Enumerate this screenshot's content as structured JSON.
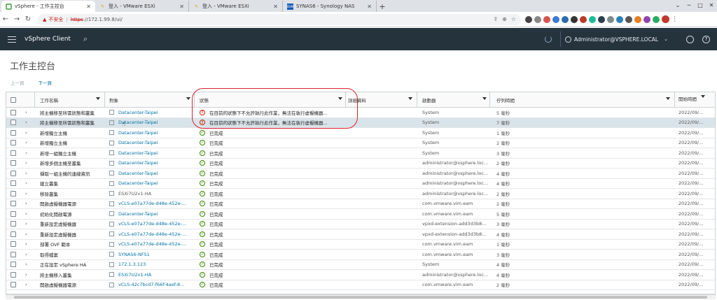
{
  "browser": {
    "tabs": [
      {
        "title": "vSphere - 工作主控台",
        "favicon": "vsphere-icon"
      },
      {
        "title": "登入 - VMware ESXi",
        "favicon": "vmware-icon"
      },
      {
        "title": "登入 - VMware ESXi",
        "favicon": "vmware-icon"
      },
      {
        "title": "SYNAS6 - Synology NAS",
        "favicon": "synology-icon"
      }
    ],
    "insecure_label": "不安全",
    "url_scheme": "https",
    "url_rest": "://172.1.99.8/ui/"
  },
  "header": {
    "brand": "vSphere Client",
    "user": "Administrator@VSPHERE.LOCAL"
  },
  "page": {
    "title": "工作主控台",
    "prev": "上一頁",
    "next": "下一頁"
  },
  "table": {
    "columns": [
      "工作名稱",
      "對象",
      "狀態",
      "詳細資料",
      "啟動器",
      "佇列時間",
      "開始時間"
    ],
    "rows": [
      {
        "task": "將主機移至所需狀態和叢集",
        "target": "Datacenter-Taipei",
        "target_link": true,
        "status": "在目前的狀態下不允許執行此作業，無法在執行虛擬機器...",
        "status_type": "error",
        "initiator": "System",
        "queued": "5 毫秒",
        "start": "2022/09/..."
      },
      {
        "task": "將主機移至所需狀態和叢集",
        "target": "Datacenter-Taipei",
        "target_link": true,
        "status": "在目前的狀態下不允許執行此作業，無法在執行虛擬機器...",
        "status_type": "error",
        "initiator": "System",
        "queued": "7 毫秒",
        "start": "2022/09/..."
      },
      {
        "task": "新增獨立主機",
        "target": "Datacenter-Taipei",
        "target_link": true,
        "status": "已完成",
        "status_type": "ok",
        "initiator": "System",
        "queued": "1 毫秒",
        "start": "2022/09/..."
      },
      {
        "task": "新增獨立主機",
        "target": "Datacenter-Taipei",
        "target_link": true,
        "status": "已完成",
        "status_type": "ok",
        "initiator": "System",
        "queued": "2 毫秒",
        "start": "2022/09/..."
      },
      {
        "task": "新增一組獨立主機",
        "target": "Datacenter-Taipei",
        "target_link": true,
        "status": "已完成",
        "status_type": "ok",
        "initiator": "System",
        "queued": "3 毫秒",
        "start": "2022/09/..."
      },
      {
        "task": "新增多個主機至叢集",
        "target": "Datacenter-Taipei",
        "target_link": true,
        "status": "已完成",
        "status_type": "ok",
        "initiator": "administrator@vsphere.loc...",
        "queued": "2 毫秒",
        "start": "2022/09/..."
      },
      {
        "task": "擷取一組主機的連線資訊",
        "target": "Datacenter-Taipei",
        "target_link": true,
        "status": "已完成",
        "status_type": "ok",
        "initiator": "administrator@vsphere.loc...",
        "queued": "4 毫秒",
        "start": "2022/09/..."
      },
      {
        "task": "建立叢集",
        "target": "Datacenter-Taipei",
        "target_link": true,
        "status": "已完成",
        "status_type": "ok",
        "initiator": "administrator@vsphere.loc...",
        "queued": "4 毫秒",
        "start": "2022/09/..."
      },
      {
        "task": "移除叢集",
        "target": "ESXi7U2v1-HA",
        "target_link": false,
        "status": "已完成",
        "status_type": "ok",
        "initiator": "administrator@vsphere.loc...",
        "queued": "2 毫秒",
        "start": "2022/09/..."
      },
      {
        "task": "開啟虛擬機器電源",
        "target": "vCLS-e07a77de-d48e-452e-...",
        "target_link": true,
        "status": "已完成",
        "status_type": "ok",
        "initiator": "com.vmware.vim.eam",
        "queued": "2 毫秒",
        "start": "2022/09/..."
      },
      {
        "task": "初始化開啟電源",
        "target": "Datacenter-Taipei",
        "target_link": true,
        "status": "已完成",
        "status_type": "ok",
        "initiator": "com.vmware.vim.eam",
        "queued": "5 毫秒",
        "start": "2022/09/..."
      },
      {
        "task": "重新設定虛擬機器",
        "target": "vCLS-e07a77de-d48e-452e-...",
        "target_link": true,
        "status": "已完成",
        "status_type": "ok",
        "initiator": "vpxd-extension-add3d3b8...",
        "queued": "3 毫秒",
        "start": "2022/09/..."
      },
      {
        "task": "重新設定虛擬機器",
        "target": "vCLS-e07a77de-d48e-452e-...",
        "target_link": true,
        "status": "已完成",
        "status_type": "ok",
        "initiator": "vpxd-extension-add3d3b8...",
        "queued": "4 毫秒",
        "start": "2022/09/..."
      },
      {
        "task": "部署 OVF 範本",
        "target": "vCLS-e07a77de-d48e-452e-...",
        "target_link": true,
        "status": "已完成",
        "status_type": "ok",
        "initiator": "com.vmware.vim.eam",
        "queued": "1 毫秒",
        "start": "2022/09/..."
      },
      {
        "task": "取得檔案",
        "target": "SYNAS6-NFS1",
        "target_link": true,
        "status": "已完成",
        "status_type": "ok",
        "initiator": "com.vmware.vim.eam",
        "queued": "3 毫秒",
        "start": "2022/09/..."
      },
      {
        "task": "正在設定 vSphere HA",
        "target": "172.1.3.123",
        "target_link": true,
        "status": "已完成",
        "status_type": "ok",
        "initiator": "System",
        "queued": "4 毫秒",
        "start": "2022/09/..."
      },
      {
        "task": "將主機移入叢集",
        "target": "ESXi7U2v1-HA",
        "target_link": true,
        "status": "已完成",
        "status_type": "ok",
        "initiator": "administrator@vsphere.loc...",
        "queued": "4 毫秒",
        "start": "2022/09/..."
      },
      {
        "task": "開啟虛擬機器電源",
        "target": "vCLS-42c7bcd7-f66f-4aef-8...",
        "target_link": true,
        "status": "已完成",
        "status_type": "ok",
        "initiator": "com.vmware.vim.eam",
        "queued": "2 毫秒",
        "start": "2022/09/..."
      }
    ]
  }
}
